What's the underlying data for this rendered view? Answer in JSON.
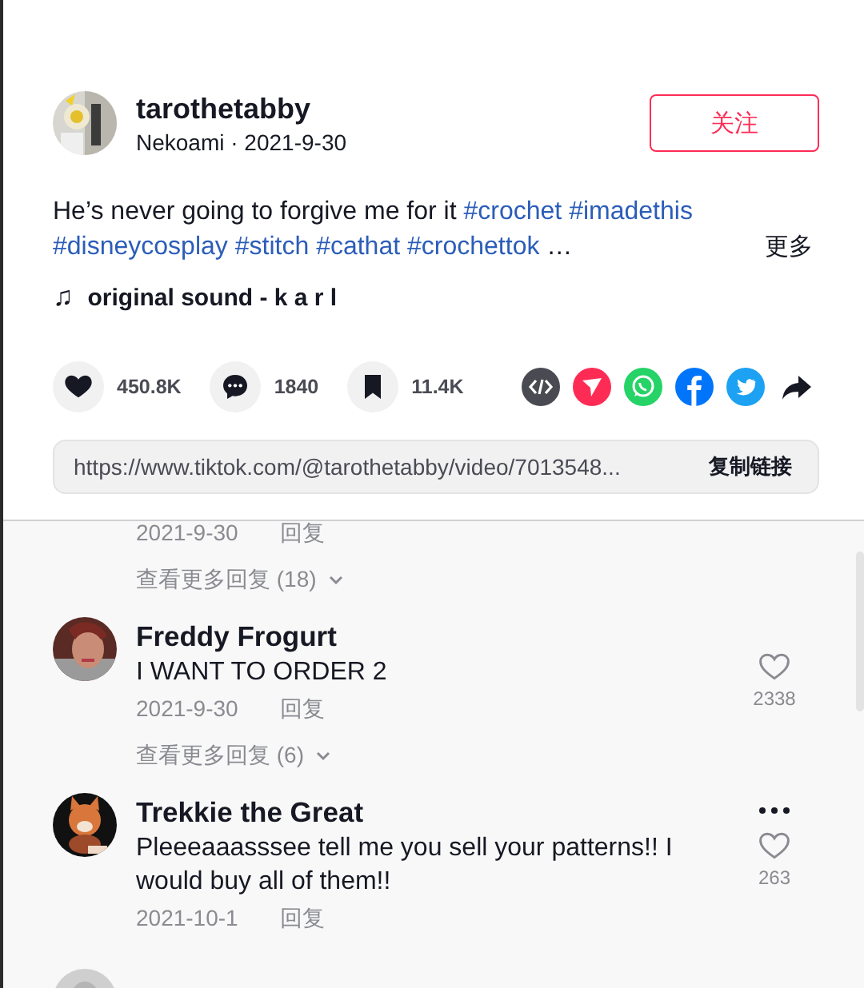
{
  "author": {
    "username": "tarothetabby",
    "meta": "Nekoami · 2021-9-30"
  },
  "follow_button": "关注",
  "description": [
    {
      "kind": "text",
      "text": "He’s never going to forgive me for it"
    },
    {
      "kind": "hashtag",
      "text": "#crochet"
    },
    {
      "kind": "hashtag",
      "text": "#imadethis"
    },
    {
      "kind": "hashtag",
      "text": "#disneycosplay"
    },
    {
      "kind": "hashtag",
      "text": "#stitch"
    },
    {
      "kind": "hashtag",
      "text": "#cathat"
    },
    {
      "kind": "hashtag",
      "text": "#crochettok"
    },
    {
      "kind": "text",
      "text": "…"
    }
  ],
  "more_link": "更多",
  "sound": {
    "icon": "♫",
    "title": "original sound - k a r l"
  },
  "stats": [
    {
      "kind": "like",
      "count": "450.8K"
    },
    {
      "kind": "comment",
      "count": "1840"
    },
    {
      "kind": "save",
      "count": "11.4K"
    }
  ],
  "link": {
    "url": "https://www.tiktok.com/@tarothetabby/video/7013548...",
    "copy_button": "复制链接"
  },
  "thread": [
    {
      "kind": "tail",
      "date": "2021-9-30",
      "reply": "回复"
    },
    {
      "kind": "more",
      "label": "查看更多回复 (18)"
    },
    {
      "kind": "comment",
      "user": "Freddy Frogurt",
      "text": "I WANT TO ORDER 2",
      "date": "2021-9-30",
      "reply": "回复",
      "likes": "2338",
      "menu_shown": false
    },
    {
      "kind": "more",
      "label": "查看更多回复 (6)"
    },
    {
      "kind": "comment",
      "user": "Trekkie the Great",
      "text": "Pleeeaaasssee tell me you sell your patterns!! I would buy all of them!!",
      "date": "2021-10-1",
      "reply": "回复",
      "likes": "263",
      "menu_shown": true
    }
  ]
}
